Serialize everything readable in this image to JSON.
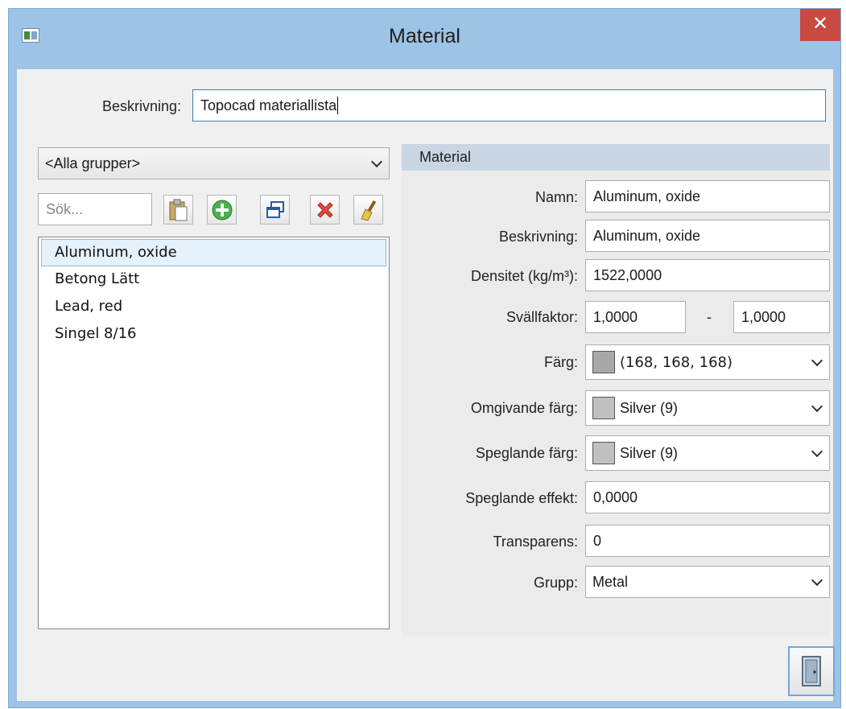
{
  "window": {
    "title": "Material",
    "close_label": "✕"
  },
  "description": {
    "label": "Beskrivning:",
    "value": "Topocad materiallista"
  },
  "group_filter": {
    "selected": "<Alla grupper>"
  },
  "search": {
    "placeholder": "Sök..."
  },
  "toolbar": [
    "paste-icon",
    "add-icon",
    "copy-icon",
    "delete-icon",
    "clean-icon"
  ],
  "materials": [
    "Aluminum, oxide",
    "Betong Lätt",
    "Lead, red",
    "Singel 8/16"
  ],
  "properties": {
    "header": "Material",
    "name_label": "Namn:",
    "name_value": "Aluminum, oxide",
    "desc_label": "Beskrivning:",
    "desc_value": "Aluminum, oxide",
    "density_label": "Densitet (kg/m³):",
    "density_value": "1522,0000",
    "swell_label": "Svällfaktor:",
    "swell_min": "1,0000",
    "swell_sep": "-",
    "swell_max": "1,0000",
    "color_label": "Färg:",
    "color_value": "(168, 168, 168)",
    "color_hex": "#a8a8a8",
    "ambient_label": "Omgivande färg:",
    "ambient_value": "Silver (9)",
    "ambient_hex": "#c0c0c0",
    "specular_label": "Speglande färg:",
    "specular_value": "Silver (9)",
    "specular_hex": "#c0c0c0",
    "spec_effect_label": "Speglande effekt:",
    "spec_effect_value": "0,0000",
    "transparency_label": "Transparens:",
    "transparency_value": "0",
    "group_label": "Grupp:",
    "group_value": "Metal"
  },
  "footer": {
    "close_icon": "door-exit-icon"
  }
}
